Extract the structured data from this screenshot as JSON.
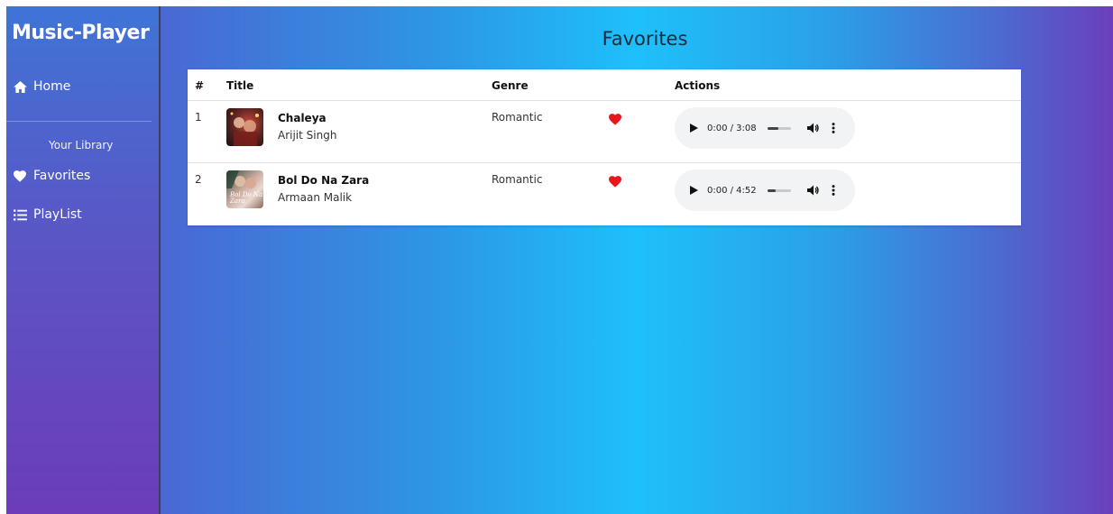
{
  "sidebar": {
    "brand": "Music-Player",
    "home_label": "Home",
    "section_title": "Your Library",
    "favorites_label": "Favorites",
    "playlist_label": "PlayList"
  },
  "main": {
    "title": "Favorites",
    "table": {
      "headers": {
        "num": "#",
        "title": "Title",
        "genre": "Genre",
        "actions": "Actions"
      },
      "rows": [
        {
          "num": "1",
          "song": "Chaleya",
          "artist": "Arijit Singh",
          "genre": "Romantic",
          "time": "0:00 / 3:08"
        },
        {
          "num": "2",
          "song": "Bol Do Na Zara",
          "artist": "Armaan Malik",
          "genre": "Romantic",
          "time": "0:00 / 4:52",
          "cover_text": "Bol Do Na Zara"
        }
      ]
    }
  },
  "colors": {
    "heart": "#e8161f",
    "sidebar_gradient_top": "#3f74d6",
    "sidebar_gradient_bottom": "#6c3cba",
    "main_gradient_center": "#1ec0fb",
    "main_gradient_edge": "#6b3fbd"
  },
  "icons": {
    "home": "home-icon",
    "favorites": "heart-icon",
    "playlist": "list-icon",
    "favorite_toggle": "heart-icon",
    "play": "play-icon",
    "volume": "volume-icon",
    "more": "more-vertical-icon"
  }
}
